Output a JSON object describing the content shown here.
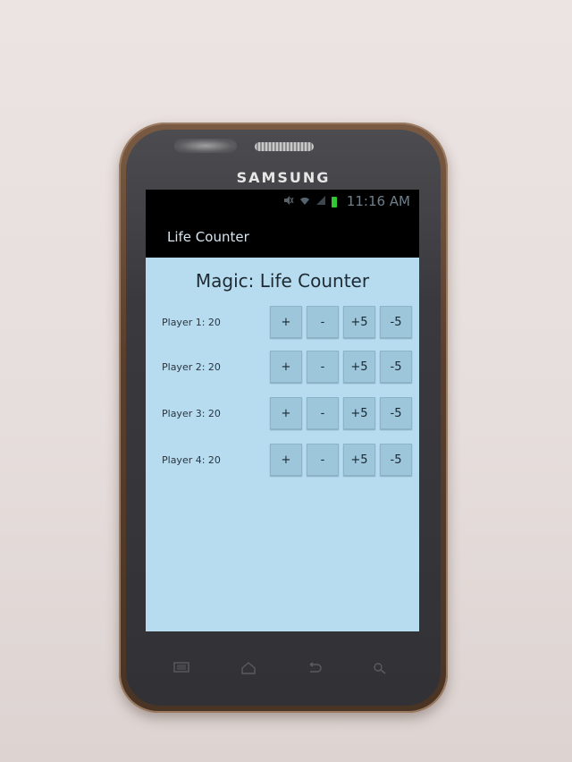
{
  "phone": {
    "brand": "SAMSUNG"
  },
  "status_bar": {
    "time": "11:16 AM",
    "icons": [
      "mute-icon",
      "wifi-icon",
      "signal-icon",
      "battery-icon"
    ]
  },
  "action_bar": {
    "title": "Life Counter"
  },
  "main": {
    "heading": "Magic: Life Counter",
    "buttons": {
      "plus_one": "+",
      "minus_one": "-",
      "plus_five": "+5",
      "minus_five": "-5"
    },
    "players": [
      {
        "label": "Player 1: 20"
      },
      {
        "label": "Player 2: 20"
      },
      {
        "label": "Player 3: 20"
      },
      {
        "label": "Player 4: 20"
      }
    ]
  },
  "nav_keys": [
    "menu-icon",
    "home-icon",
    "back-icon",
    "search-icon"
  ],
  "colors": {
    "content_background": "#b7dcef",
    "button": "#9ec6db",
    "battery": "#32c832"
  }
}
